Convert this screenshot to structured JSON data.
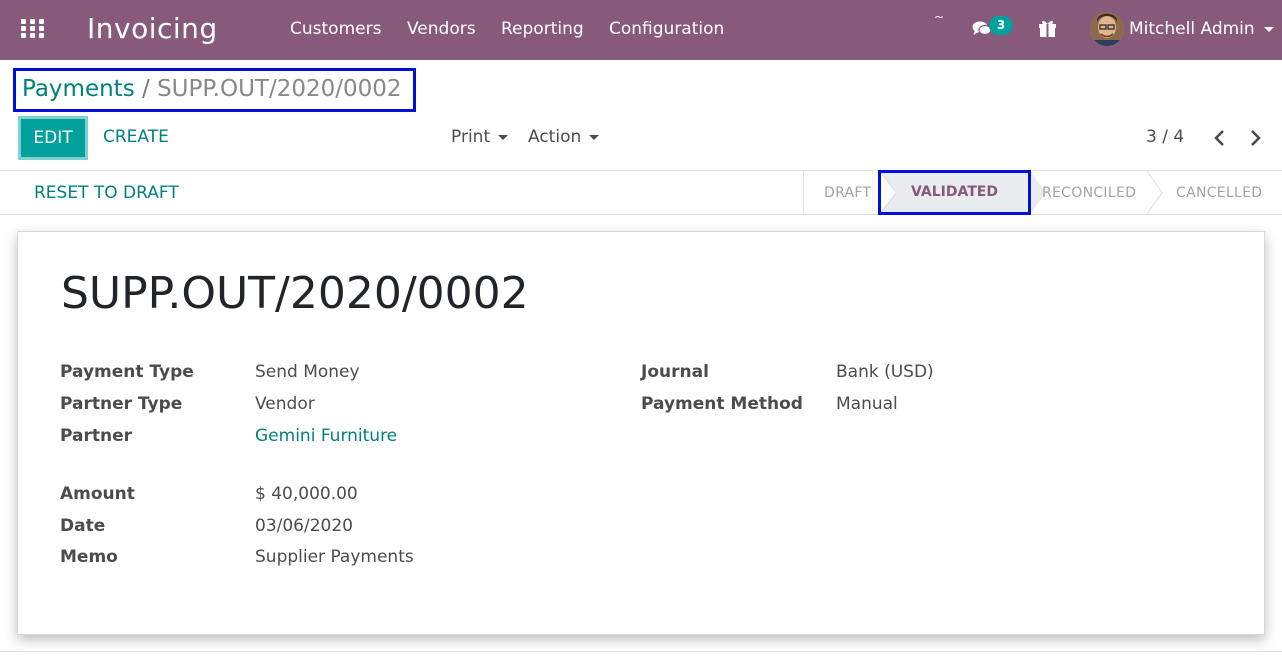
{
  "navbar": {
    "app_title": "Invoicing",
    "menu": [
      "Customers",
      "Vendors",
      "Reporting",
      "Configuration"
    ],
    "tilde": "~",
    "messages_count": "3",
    "user_name": "Mitchell Admin",
    "brand_color": "#875a7b"
  },
  "control_panel": {
    "breadcrumb_parent": "Payments",
    "breadcrumb_separator": "/",
    "breadcrumb_current": "SUPP.OUT/2020/0002",
    "edit_label": "EDIT",
    "create_label": "CREATE",
    "print_label": "Print",
    "action_label": "Action",
    "pager": "3 / 4"
  },
  "statusbar": {
    "reset_label": "RESET TO DRAFT",
    "stages": {
      "draft": "DRAFT",
      "validated": "VALIDATED",
      "reconciled": "RECONCILED",
      "cancelled": "CANCELLED"
    },
    "active_stage": "VALIDATED"
  },
  "record": {
    "title": "SUPP.OUT/2020/0002",
    "fields": {
      "payment_type": {
        "label": "Payment Type",
        "value": "Send Money"
      },
      "partner_type": {
        "label": "Partner Type",
        "value": "Vendor"
      },
      "partner": {
        "label": "Partner",
        "value": "Gemini Furniture"
      },
      "amount": {
        "label": "Amount",
        "value": "$ 40,000.00"
      },
      "date": {
        "label": "Date",
        "value": "03/06/2020"
      },
      "memo": {
        "label": "Memo",
        "value": "Supplier Payments"
      },
      "journal": {
        "label": "Journal",
        "value": "Bank (USD)"
      },
      "payment_method": {
        "label": "Payment Method",
        "value": "Manual"
      }
    }
  },
  "colors": {
    "accent": "#00a09d",
    "link": "#00817d",
    "highlight_box": "#0010d7"
  }
}
